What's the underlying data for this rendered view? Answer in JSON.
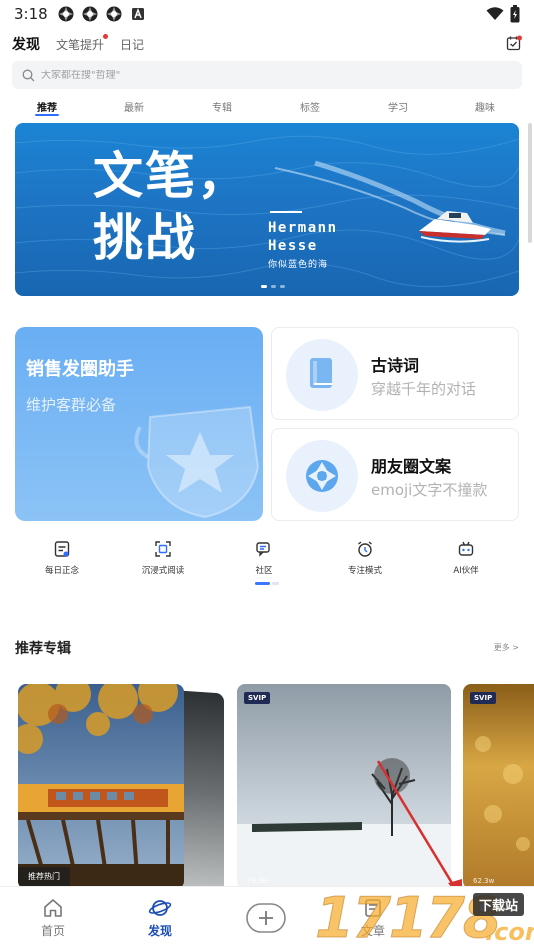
{
  "status_bar": {
    "time": "3:18",
    "left_icons": [
      "app-icon",
      "app-icon",
      "app-icon",
      "a-box-icon"
    ],
    "right_icons": [
      "wifi-icon",
      "battery-icon"
    ]
  },
  "top_tabs": [
    {
      "label": "发现",
      "active": true
    },
    {
      "label": "文笔提升",
      "dot": true
    },
    {
      "label": "日记"
    }
  ],
  "calendar_icon": "calendar-check-icon",
  "search": {
    "placeholder": "大家都在搜\"哲理\""
  },
  "sub_tabs": [
    "推荐",
    "最新",
    "专辑",
    "标签",
    "学习",
    "趣味"
  ],
  "banner": {
    "title_line1": "文笔，",
    "title_line2": "挑战",
    "sub_line1": "Hermann",
    "sub_line2": "Hesse",
    "sub_caption": "你似蓝色的海",
    "page_count": 3,
    "active_page": 0
  },
  "feature_cards": {
    "sales": {
      "title": "销售发圈助手",
      "subtitle": "维护客群必备"
    },
    "poetry": {
      "title": "古诗词",
      "subtitle": "穿越千年的对话",
      "icon": "book-icon"
    },
    "moments": {
      "title": "朋友圈文案",
      "subtitle": "emoji文字不撞款",
      "icon": "aperture-icon"
    }
  },
  "quick_nav": [
    {
      "label": "每日正念",
      "icon": "note-icon"
    },
    {
      "label": "沉浸式阅读",
      "icon": "focus-frame-icon"
    },
    {
      "label": "社区",
      "icon": "chat-bubbles-icon"
    },
    {
      "label": "专注模式",
      "icon": "alarm-clock-icon"
    },
    {
      "label": "AI伙伴",
      "icon": "robot-icon"
    }
  ],
  "section": {
    "title": "推荐专辑",
    "more": "更多 >"
  },
  "albums": [
    {
      "tag": "推荐热门"
    },
    {
      "badge": "SVIP",
      "count": "79.3w"
    },
    {
      "badge": "SVIP",
      "count": "62.3w"
    }
  ],
  "bottom_nav": [
    {
      "label": "首页",
      "icon": "home-icon"
    },
    {
      "label": "发现",
      "icon": "planet-icon",
      "active": true
    },
    {
      "label": "",
      "icon": "plus-icon"
    },
    {
      "label": "文章",
      "icon": "article-icon"
    }
  ],
  "watermark": {
    "numbers": "17178",
    "badge": "下载站",
    "domain": ".com"
  },
  "colors": {
    "accent": "#2f6fff",
    "nav_active": "#1d4fb8",
    "banner_blue": "#1e76c6",
    "card_blue": "#69aef3"
  }
}
